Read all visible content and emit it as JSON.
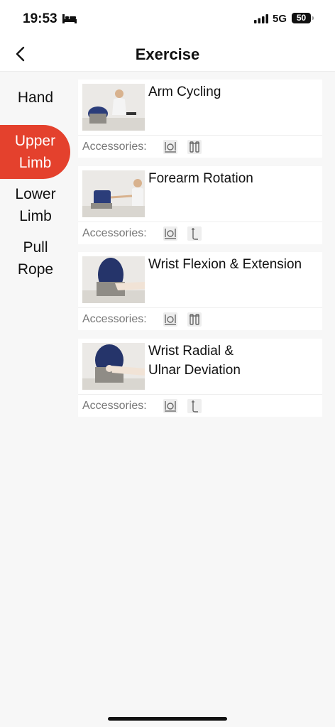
{
  "status": {
    "time": "19:53",
    "network": "5G",
    "battery": "50"
  },
  "header": {
    "title": "Exercise"
  },
  "sidebar": {
    "items": [
      {
        "label": "Hand",
        "active": false
      },
      {
        "label": "Upper\nLimb",
        "active": true
      },
      {
        "label": "Lower\nLimb",
        "active": false
      },
      {
        "label": "Pull\nRope",
        "active": false
      }
    ]
  },
  "accessories_label": "Accessories:",
  "exercises": [
    {
      "title": "Arm Cycling",
      "accessories": [
        "cycle-handle-icon",
        "double-handle-icon"
      ]
    },
    {
      "title": "Forearm Rotation",
      "accessories": [
        "cycle-handle-icon",
        "single-grip-icon"
      ]
    },
    {
      "title": "Wrist Flexion & Extension",
      "accessories": [
        "cycle-handle-icon",
        "double-handle-icon"
      ]
    },
    {
      "title": "Wrist Radial &\nUlnar Deviation",
      "accessories": [
        "cycle-handle-icon",
        "single-grip-icon"
      ]
    }
  ],
  "colors": {
    "accent": "#e4412d",
    "background": "#f7f7f7"
  }
}
